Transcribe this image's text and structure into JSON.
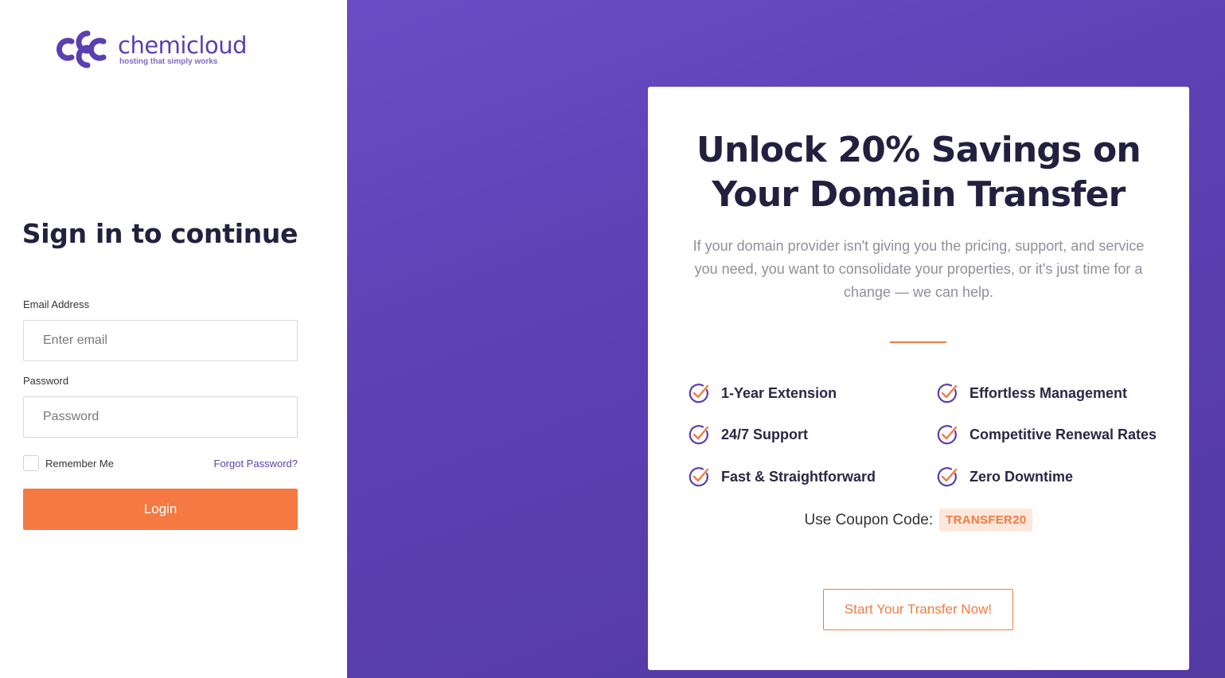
{
  "brand": {
    "name": "chemicloud",
    "tagline": "hosting that simply works",
    "primary_color": "#5b3fb0",
    "accent_color": "#f47a41"
  },
  "login": {
    "title": "Sign in to continue",
    "email_label": "Email Address",
    "email_placeholder": "Enter email",
    "password_label": "Password",
    "password_placeholder": "Password",
    "remember_label": "Remember Me",
    "forgot_label": "Forgot Password?",
    "login_button": "Login"
  },
  "promo": {
    "title_line1": "Unlock 20% Savings on",
    "title_line2": "Your Domain Transfer",
    "description": "If your domain provider isn't giving you the pricing, support, and service you need, you want to consolidate your properties, or it's just time for a change — we can help.",
    "features": [
      "1-Year Extension",
      "Effortless Management",
      "24/7 Support",
      "Competitive Renewal Rates",
      "Fast & Straightforward",
      "Zero Downtime"
    ],
    "coupon_label": "Use Coupon Code:",
    "coupon_code": "TRANSFER20",
    "cta_label": "Start Your Transfer Now!"
  }
}
